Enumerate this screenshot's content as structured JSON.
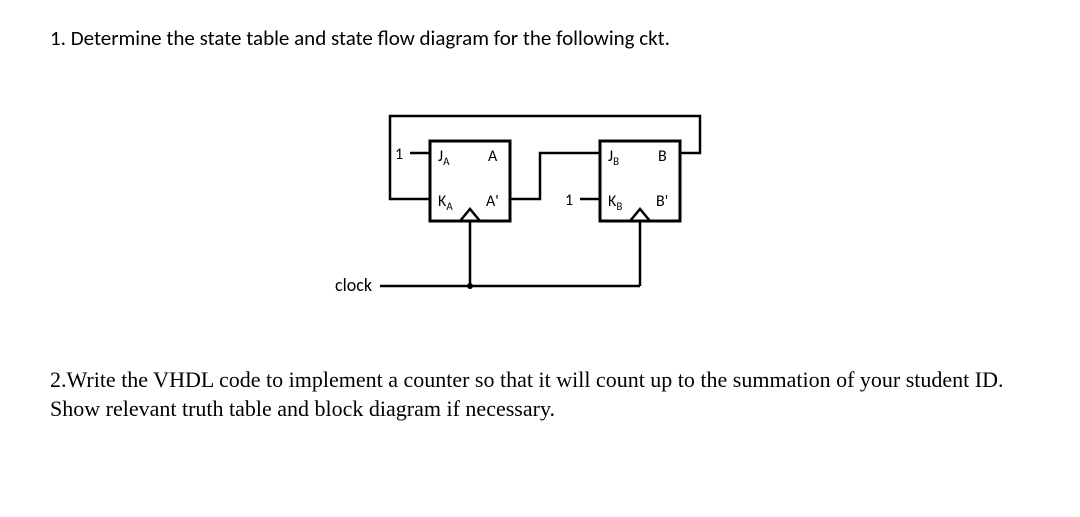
{
  "q1": {
    "text": "1. Determine the state table and state flow diagram for the following ckt."
  },
  "q2": {
    "text": "2.Write the VHDL code to implement a counter so that it will count up to the summation of your student ID. Show relevant truth table and block diagram if necessary."
  },
  "circuit": {
    "clock_label": "clock",
    "ffA": {
      "j_label": "J",
      "j_sub": "A",
      "k_label": "K",
      "k_sub": "A",
      "q_label": "A",
      "qn_label": "A'",
      "j_input": "1"
    },
    "ffB": {
      "j_label": "J",
      "j_sub": "B",
      "k_label": "K",
      "k_sub": "B",
      "q_label": "B",
      "qn_label": "B'",
      "k_input": "1"
    }
  }
}
